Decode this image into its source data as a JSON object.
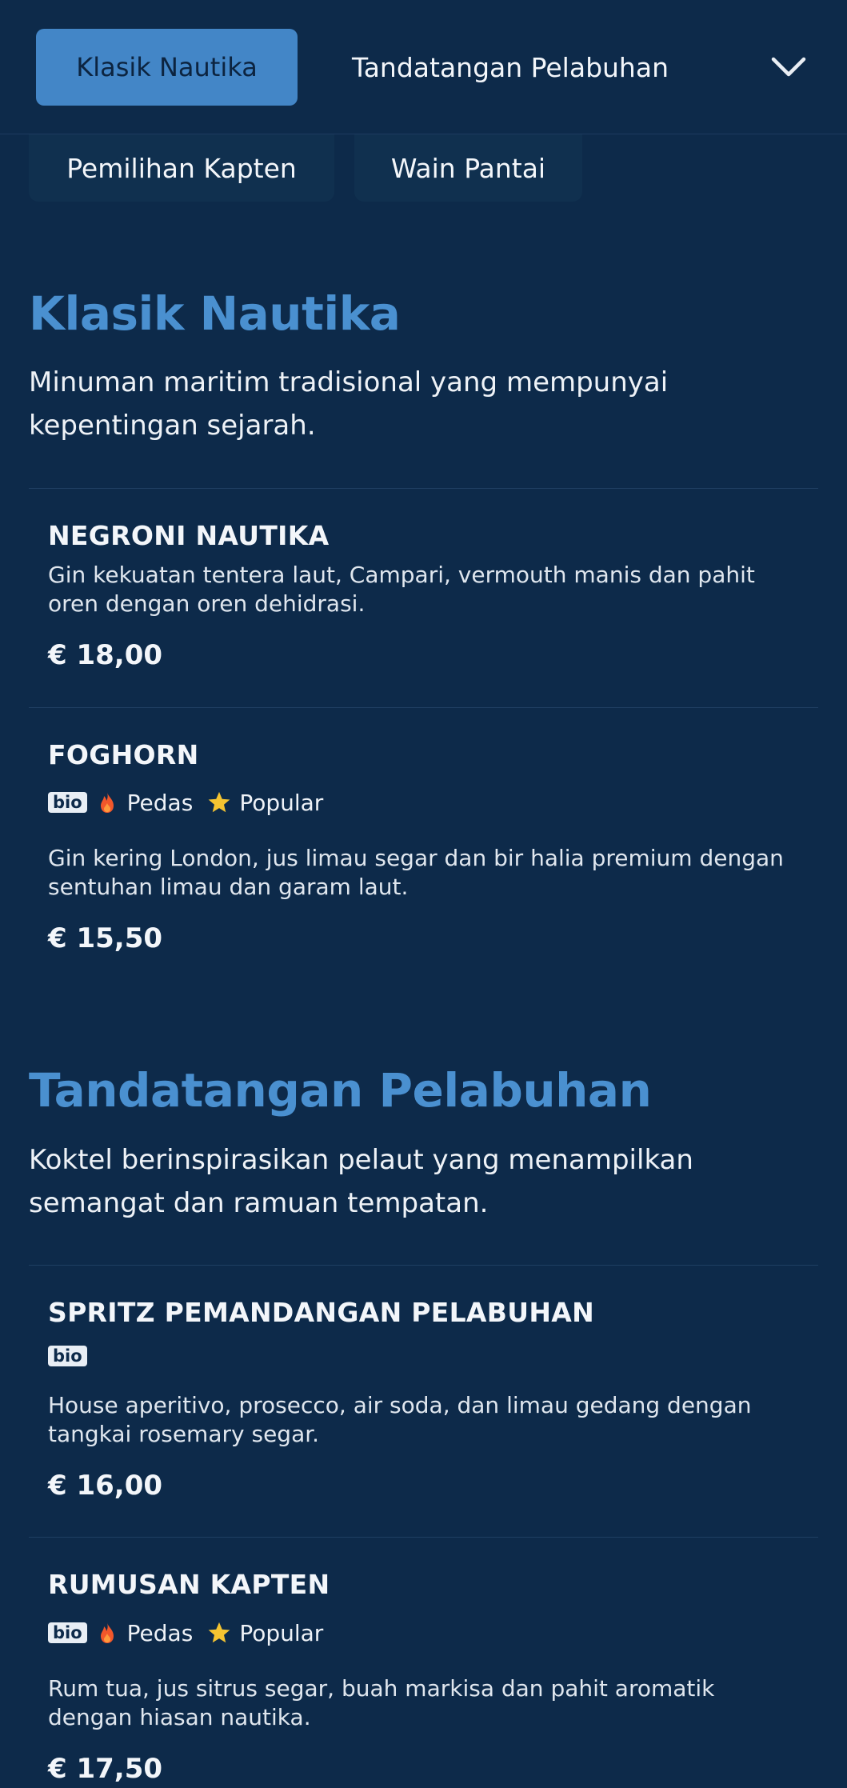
{
  "nav": {
    "active_tab": "Klasik Nautika",
    "next_tab": "Tandatangan Pelabuhan",
    "subtabs": [
      "Pemilihan Kapten",
      "Wain Pantai"
    ]
  },
  "sections": [
    {
      "title": "Klasik Nautika",
      "description": "Minuman maritim tradisional yang mempunyai kepentingan sejarah.",
      "items": [
        {
          "name": "NEGRONI NAUTIKA",
          "description": "Gin kekuatan tentera laut, Campari, vermouth manis dan pahit oren dengan oren dehidrasi.",
          "price": "€ 18,00"
        },
        {
          "name": "FOGHORN",
          "tags": {
            "bio": "bio",
            "spicy": "Pedas",
            "popular": "Popular"
          },
          "description": "Gin kering London, jus limau segar dan bir halia premium dengan sentuhan limau dan garam laut.",
          "price": "€ 15,50"
        }
      ]
    },
    {
      "title": "Tandatangan Pelabuhan",
      "description": "Koktel berinspirasikan pelaut yang menampilkan semangat dan ramuan tempatan.",
      "items": [
        {
          "name": "SPRITZ PEMANDANGAN PELABUHAN",
          "tags": {
            "bio": "bio"
          },
          "description": "House aperitivo, prosecco, air soda, dan limau gedang dengan tangkai rosemary segar.",
          "price": "€ 16,00"
        },
        {
          "name": "RUMUSAN KAPTEN",
          "tags": {
            "bio": "bio",
            "spicy": "Pedas",
            "popular": "Popular"
          },
          "description": "Rum tua, jus sitrus segar, buah markisa dan pahit aromatik dengan hiasan nautika.",
          "price": "€ 17,50"
        }
      ]
    }
  ],
  "colors": {
    "background": "#0d2a4a",
    "accent": "#4386c7",
    "section_title": "#4a90d0",
    "flame": "#f2572b",
    "star": "#f5c431"
  },
  "icons": [
    "chevron-down-icon",
    "flame-icon",
    "star-icon"
  ]
}
